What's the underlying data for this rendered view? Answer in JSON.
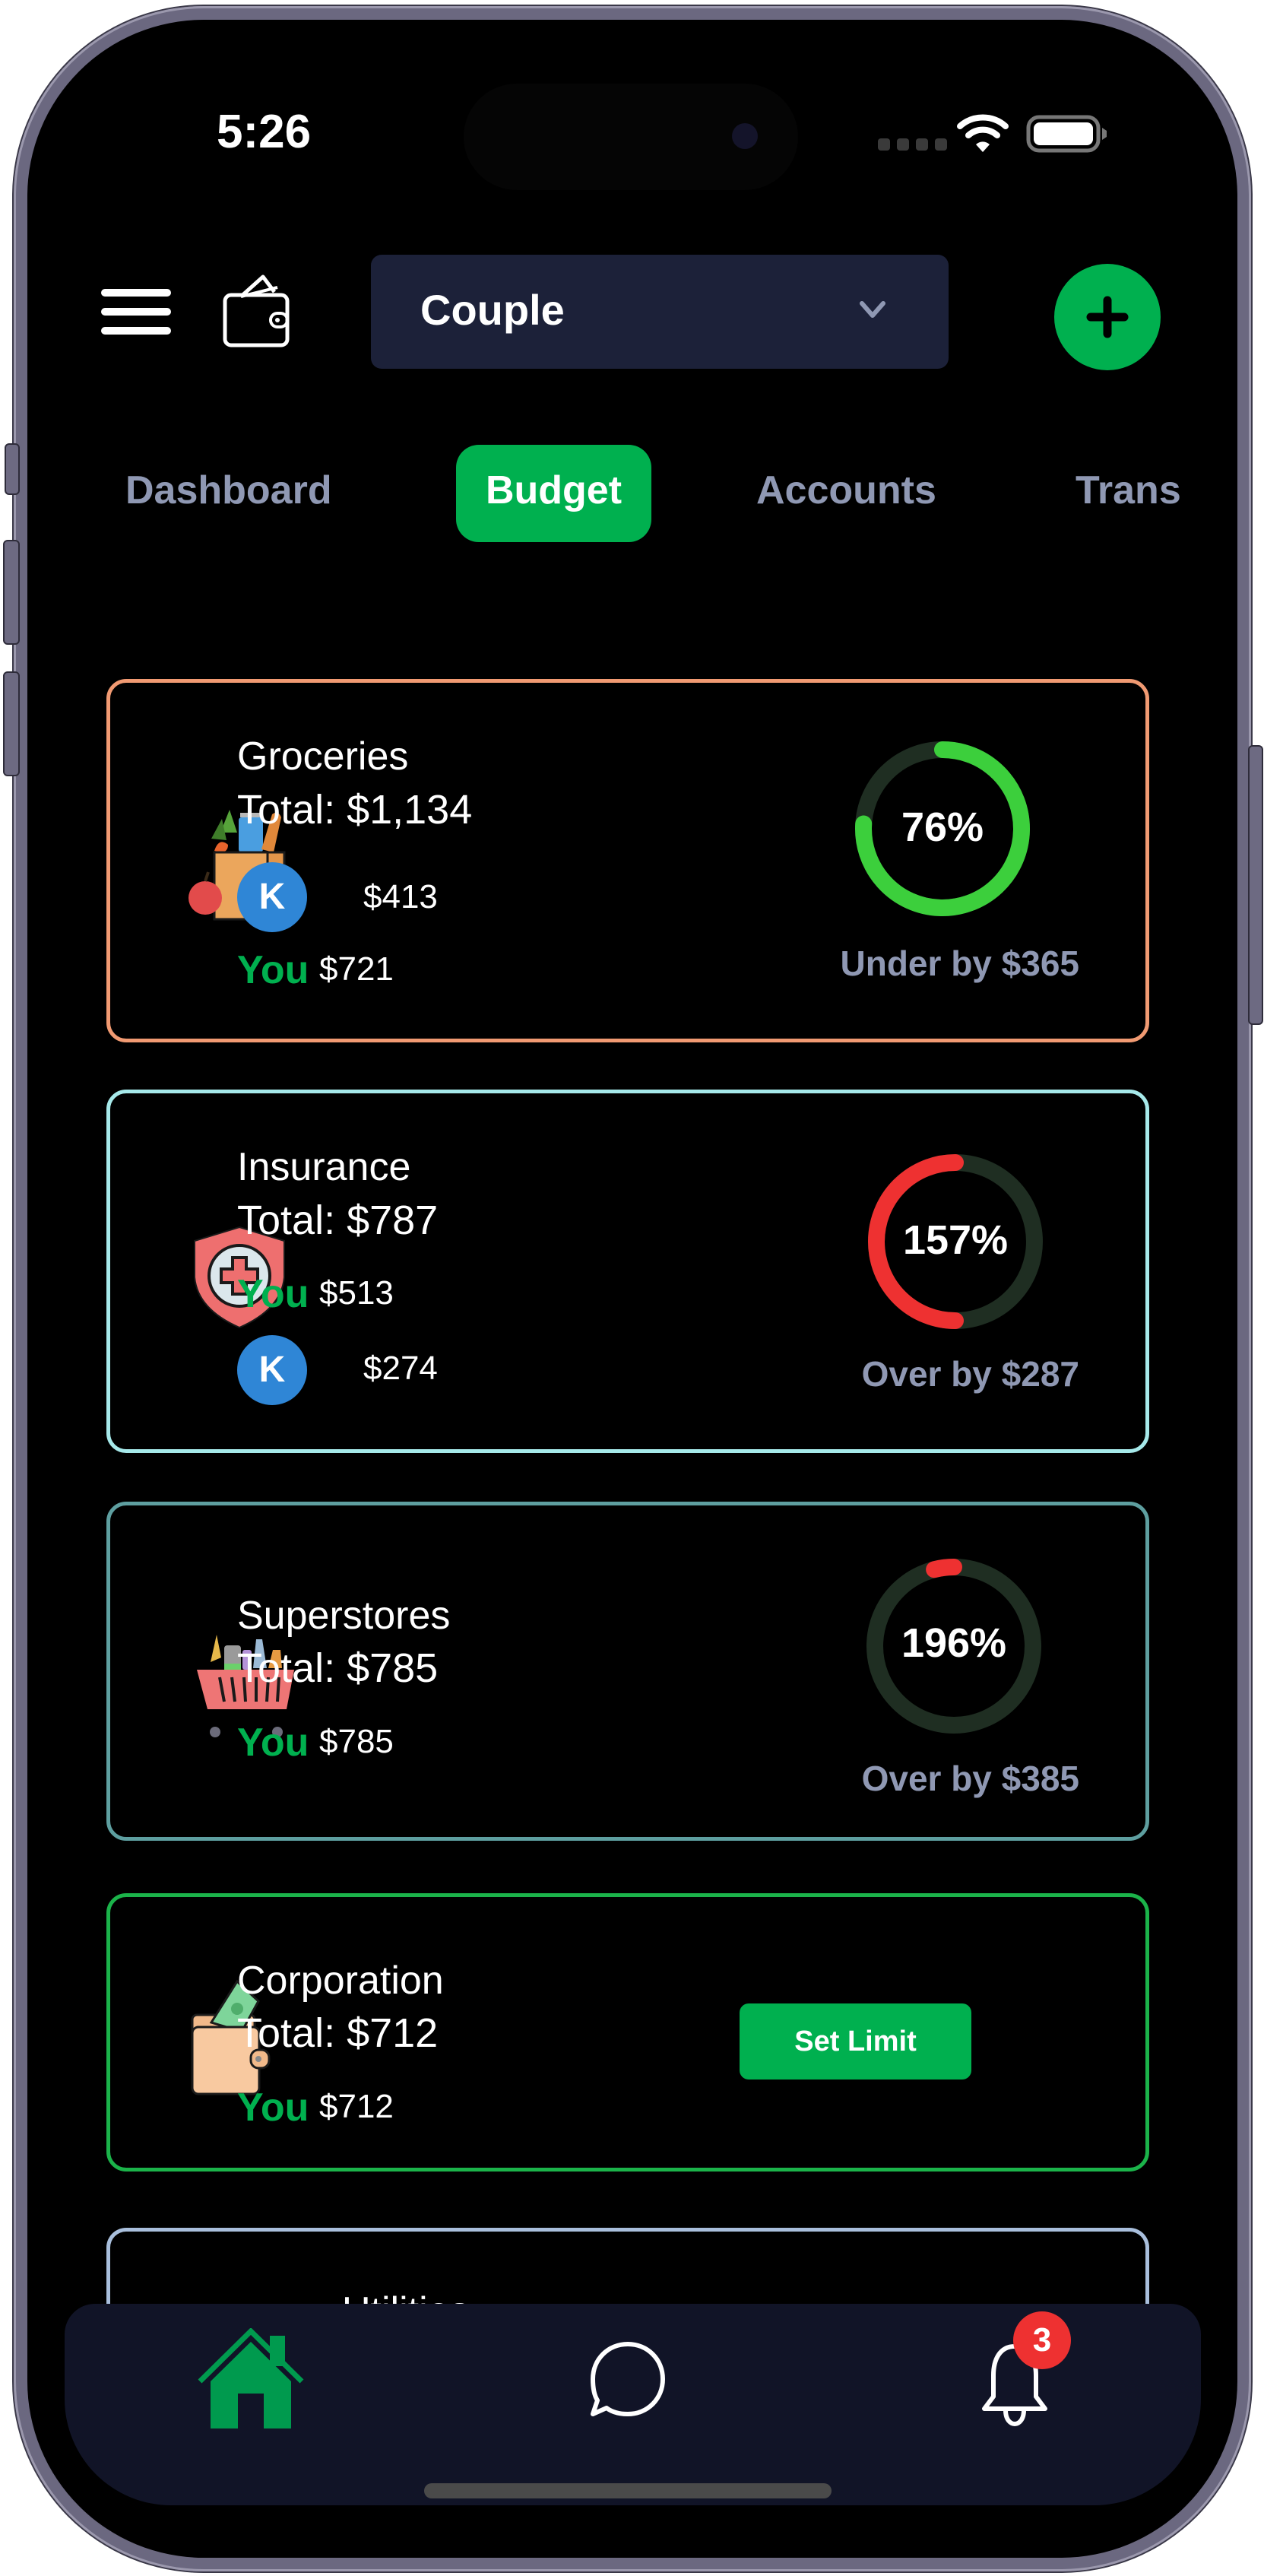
{
  "status_bar": {
    "time": "5:26",
    "signal_icon": "cellular-signal-icon",
    "wifi_icon": "wifi-icon",
    "battery_icon": "battery-icon"
  },
  "header": {
    "menu_icon": "hamburger-menu-icon",
    "wallet_icon": "wallet-icon",
    "group_selector": {
      "selected": "Couple",
      "chevron_icon": "chevron-down-icon"
    },
    "add_icon": "plus-icon"
  },
  "tabs": [
    {
      "label": "Dashboard",
      "active": false
    },
    {
      "label": "Budget",
      "active": true
    },
    {
      "label": "Accounts",
      "active": false
    },
    {
      "label": "Trans",
      "active": false
    }
  ],
  "budget_cards": [
    {
      "category": "Groceries",
      "icon": "grocery-bag-icon",
      "total": "Total: $1,134",
      "border_color": "#f19a72",
      "contributors": [
        {
          "type": "avatar",
          "initial": "K",
          "amount": "$413"
        },
        {
          "type": "you",
          "label": "You",
          "amount": "$721"
        }
      ],
      "progress": {
        "percent_label": "76%",
        "status": "under",
        "arc_fraction": 0.76,
        "arc_color": "#3ccf3c",
        "caption": "Under by $365"
      }
    },
    {
      "category": "Insurance",
      "icon": "health-insurance-shield-icon",
      "total": "Total: $787",
      "border_color": "#a6e9ea",
      "contributors": [
        {
          "type": "you",
          "label": "You",
          "amount": "$513"
        },
        {
          "type": "avatar",
          "initial": "K",
          "amount": "$274"
        }
      ],
      "progress": {
        "percent_label": "157%",
        "status": "over",
        "arc_fraction": 0.5,
        "arc_color": "#ee3131",
        "caption": "Over by $287"
      }
    },
    {
      "category": "Superstores",
      "icon": "shopping-cart-icon",
      "total": "Total: $785",
      "border_color": "#5e9fa0",
      "contributors": [
        {
          "type": "you",
          "label": "You",
          "amount": "$785"
        }
      ],
      "progress": {
        "percent_label": "196%",
        "status": "over",
        "arc_fraction": 0.04,
        "arc_color": "#ee3131",
        "caption": "Over by $385"
      }
    },
    {
      "category": "Corporation",
      "icon": "money-wallet-icon",
      "total": "Total: $712",
      "border_color": "#1bb34a",
      "contributors": [
        {
          "type": "you",
          "label": "You",
          "amount": "$712"
        }
      ],
      "action": {
        "label": "Set Limit"
      }
    },
    {
      "category": "Utilities",
      "border_color": "#a9bfdc"
    }
  ],
  "bottom_nav": {
    "items": [
      {
        "name": "home",
        "icon": "home-icon",
        "active": true
      },
      {
        "name": "chat",
        "icon": "chat-bubble-icon",
        "active": false
      },
      {
        "name": "notifications",
        "icon": "bell-icon",
        "active": false,
        "badge": "3"
      }
    ]
  },
  "colors": {
    "accent": "#00b04f",
    "ring_track": "#1f2e22",
    "muted_text": "#8f98b3",
    "avatar": "#2f86d6",
    "nav_bg": "#111427"
  }
}
